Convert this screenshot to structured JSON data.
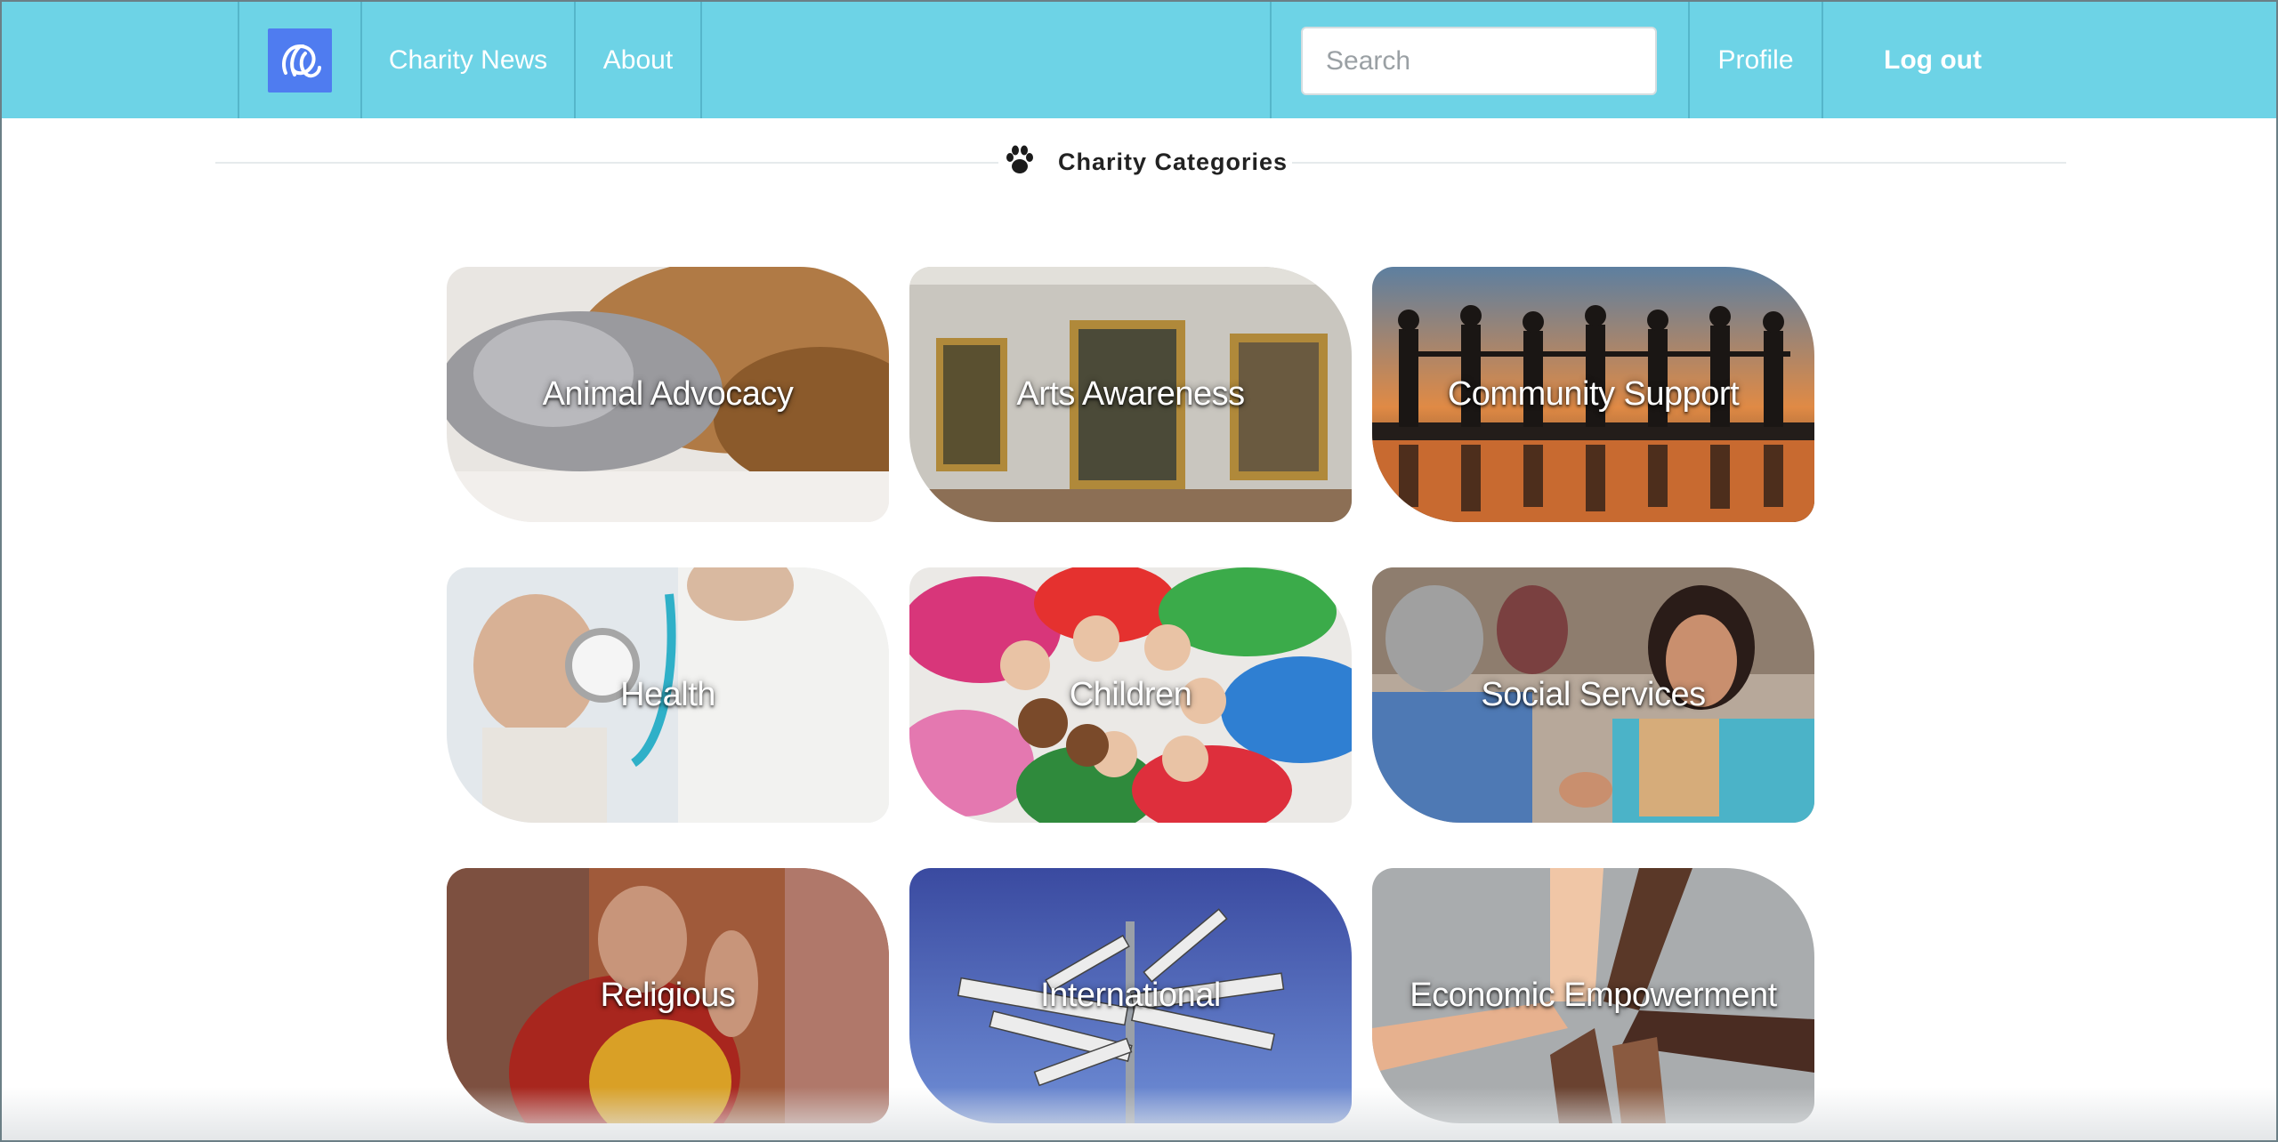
{
  "navbar": {
    "logo_icon": "charity-logo-icon",
    "links": {
      "news": "Charity News",
      "about": "About"
    },
    "search": {
      "placeholder": "Search",
      "value": ""
    },
    "profile": "Profile",
    "logout": "Log out",
    "colors": {
      "background": "#6dd3e6",
      "logo": "#4f7cf0",
      "text": "#ffffff"
    }
  },
  "section": {
    "icon": "paw-icon",
    "title": "Charity Categories"
  },
  "categories": [
    {
      "label": "Animal Advocacy",
      "image": "kitten-and-puppy-photo"
    },
    {
      "label": "Arts Awareness",
      "image": "art-gallery-photo"
    },
    {
      "label": "Community Support",
      "image": "silhouettes-holding-hands-photo"
    },
    {
      "label": "Health",
      "image": "doctor-stethoscope-photo"
    },
    {
      "label": "Children",
      "image": "children-circle-photo"
    },
    {
      "label": "Social Services",
      "image": "social-worker-photo"
    },
    {
      "label": "Religious",
      "image": "monk-praying-photo"
    },
    {
      "label": "International",
      "image": "country-signpost-photo"
    },
    {
      "label": "Economic Empowerment",
      "image": "linked-hands-photo"
    }
  ]
}
